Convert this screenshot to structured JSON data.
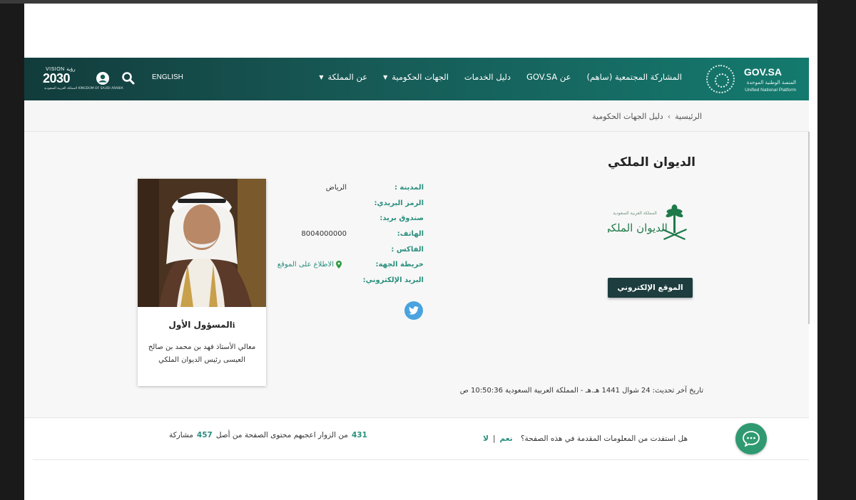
{
  "header": {
    "logo": {
      "title": "GOV.SA",
      "subtitle_ar": "المنصة الوطنية الموحدة",
      "subtitle_en": "Unified National Platform"
    },
    "nav": [
      {
        "label": "عن المملكة",
        "has_caret": true
      },
      {
        "label": "الجهات الحكومية",
        "has_caret": true
      },
      {
        "label": "دليل الخدمات",
        "has_caret": false
      },
      {
        "label": "عن GOV.SA",
        "has_caret": false
      },
      {
        "label": "المشاركة المجتمعية (ساهم)",
        "has_caret": false
      }
    ],
    "language": "ENGLISH",
    "vision": {
      "line1": "VISION رؤية",
      "line2": "2030",
      "line3": "المملكة العربية السعودية KINGDOM OF SAUDI ARABIA"
    },
    "icons": [
      "search-icon",
      "user-icon"
    ]
  },
  "breadcrumb": {
    "home": "الرئيسية",
    "current": "دليل الجهات الحكومية"
  },
  "entity": {
    "name": "الديوان الملكي",
    "emblem_text": "الديوان الملكي",
    "emblem_small": "المملكة العربية السعودية",
    "website_button": "الموقع الإلكتروني",
    "info": [
      {
        "label": "المدينة :",
        "value": "الرياض"
      },
      {
        "label": "الرمز البريدي:",
        "value": ""
      },
      {
        "label": "صندوق بريد:",
        "value": ""
      },
      {
        "label": "الهاتف:",
        "value": "8004000000"
      },
      {
        "label": "الفاكس :",
        "value": ""
      },
      {
        "label": "خريطة الجهة:",
        "value": ""
      },
      {
        "label": "البريد الإلكتروني:",
        "value": ""
      }
    ],
    "map_link": "الاطلاع على الموقع",
    "updated": "تاريخ آخر تحديث: 24 شوال 1441 هـ.هـ - المملكة العربية السعودية 10:50:36 ص"
  },
  "official": {
    "title": "المسؤول الأول",
    "description": "معالي الأستاذ فهد بن محمد بن صالح العيسى رئيس الديوان الملكي"
  },
  "feedback": {
    "question": "هل استفدت من المعلومات المقدمة في هذه الصفحة؟",
    "yes": "نعم",
    "separator": "|",
    "no": "لا",
    "liked_count": "431",
    "liked_text": "من الزوار اعجبهم محتوى الصفحة من أصل",
    "total_count": "457",
    "total_text": "مشاركة"
  },
  "colors": {
    "header_start": "#123c3c",
    "header_end": "#147a6e",
    "accent": "#2a8f7e",
    "button_dark": "#1d3d3e",
    "chat": "#2f9a71",
    "twitter": "#4aa3df"
  }
}
